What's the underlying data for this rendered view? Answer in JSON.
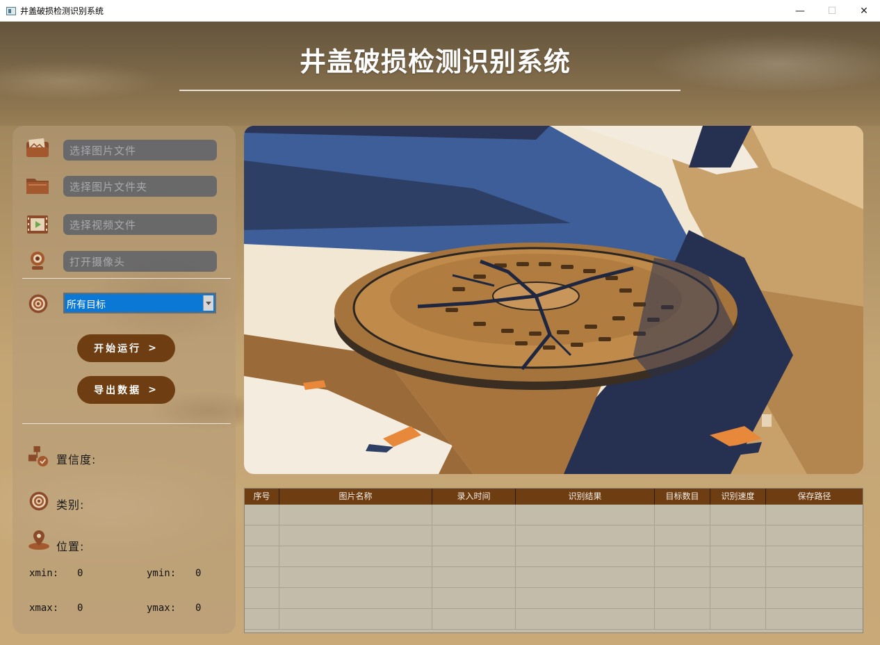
{
  "window": {
    "title": "井盖破损检测识别系统",
    "minimize_glyph": "—",
    "maximize_glyph": "☐",
    "close_glyph": "✕"
  },
  "app": {
    "title": "井盖破损检测识别系统"
  },
  "sidebar": {
    "sources": [
      {
        "label": "选择图片文件",
        "icon": "image-folder-icon"
      },
      {
        "label": "选择图片文件夹",
        "icon": "folder-icon"
      },
      {
        "label": "选择视频文件",
        "icon": "video-file-icon"
      },
      {
        "label": "打开摄像头",
        "icon": "webcam-icon"
      }
    ],
    "target_select": {
      "icon": "target-icon",
      "selected": "所有目标"
    },
    "start_button": {
      "label": "开始运行",
      "chevron": ">"
    },
    "export_button": {
      "label": "导出数据",
      "chevron": ">"
    },
    "info": {
      "confidence_label": "置信度:",
      "class_label": "类别:",
      "position_label": "位置:",
      "xmin_label": "xmin:",
      "xmin_value": "0",
      "ymin_label": "ymin:",
      "ymin_value": "0",
      "xmax_label": "xmax:",
      "xmax_value": "0",
      "ymax_label": "ymax:",
      "ymax_value": "0"
    }
  },
  "colors": {
    "accent_brown": "#6e3e12",
    "select_blue": "#0a78d4",
    "icon_brown": "#8b4a2a"
  },
  "table": {
    "columns": [
      "序号",
      "图片名称",
      "录入时间",
      "识别结果",
      "目标数目",
      "识别速度",
      "保存路径"
    ],
    "rows": [
      [
        "",
        "",
        "",
        "",
        "",
        "",
        ""
      ],
      [
        "",
        "",
        "",
        "",
        "",
        "",
        ""
      ],
      [
        "",
        "",
        "",
        "",
        "",
        "",
        ""
      ],
      [
        "",
        "",
        "",
        "",
        "",
        "",
        ""
      ],
      [
        "",
        "",
        "",
        "",
        "",
        "",
        ""
      ],
      [
        "",
        "",
        "",
        "",
        "",
        "",
        ""
      ]
    ]
  }
}
